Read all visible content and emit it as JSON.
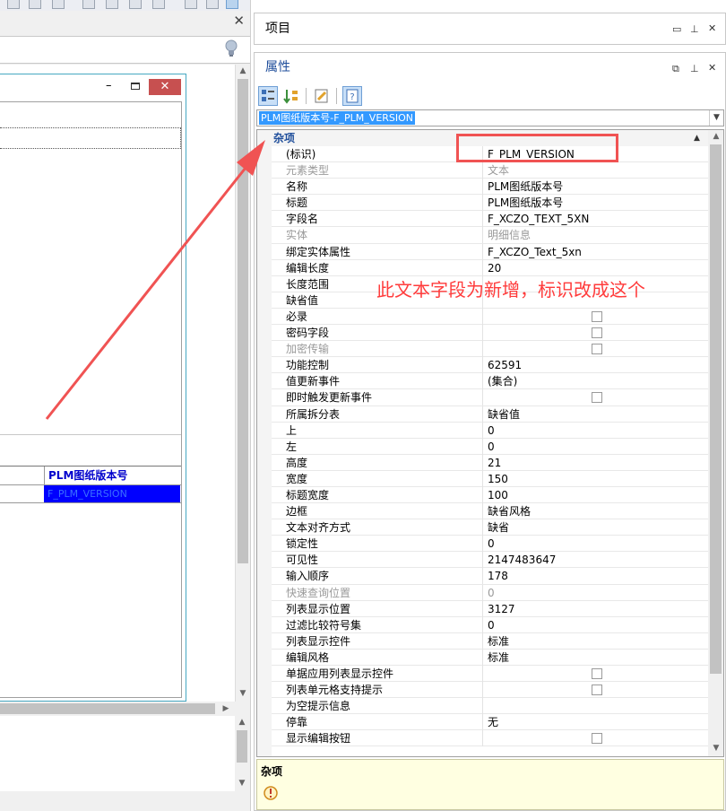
{
  "left_panel": {
    "grid_header": "PLM图纸版本号",
    "grid_cell": "F_PLM_VERSION"
  },
  "project_panel": {
    "title": "项目"
  },
  "properties_panel": {
    "title": "属性",
    "object_selector": "PLM图纸版本号-F_PLM_VERSION",
    "category": "杂项",
    "rows": [
      {
        "name": "(标识)",
        "value": "F_PLM_VERSION",
        "disabled": false
      },
      {
        "name": "元素类型",
        "value": "文本",
        "disabled": true
      },
      {
        "name": "名称",
        "value": "PLM图纸版本号",
        "disabled": false
      },
      {
        "name": "标题",
        "value": "PLM图纸版本号",
        "disabled": false
      },
      {
        "name": "字段名",
        "value": "F_XCZO_TEXT_5XN",
        "disabled": false
      },
      {
        "name": "实体",
        "value": "明细信息",
        "disabled": true
      },
      {
        "name": "绑定实体属性",
        "value": "F_XCZO_Text_5xn",
        "disabled": false
      },
      {
        "name": "编辑长度",
        "value": "20",
        "disabled": false
      },
      {
        "name": "长度范围",
        "value": "",
        "disabled": false
      },
      {
        "name": "缺省值",
        "value": "",
        "disabled": false
      },
      {
        "name": "必录",
        "value": "",
        "checkbox": true,
        "disabled": false
      },
      {
        "name": "密码字段",
        "value": "",
        "checkbox": true,
        "disabled": false
      },
      {
        "name": "加密传输",
        "value": "",
        "checkbox": true,
        "disabled": true
      },
      {
        "name": "功能控制",
        "value": "62591",
        "disabled": false
      },
      {
        "name": "值更新事件",
        "value": "(集合)",
        "disabled": false
      },
      {
        "name": "即时触发更新事件",
        "value": "",
        "checkbox": true,
        "disabled": false
      },
      {
        "name": "所属拆分表",
        "value": "缺省值",
        "disabled": false
      },
      {
        "name": "上",
        "value": "0",
        "disabled": false
      },
      {
        "name": "左",
        "value": "0",
        "disabled": false
      },
      {
        "name": "高度",
        "value": "21",
        "disabled": false
      },
      {
        "name": "宽度",
        "value": "150",
        "disabled": false
      },
      {
        "name": "标题宽度",
        "value": "100",
        "disabled": false
      },
      {
        "name": "边框",
        "value": "缺省风格",
        "disabled": false
      },
      {
        "name": "文本对齐方式",
        "value": "缺省",
        "disabled": false
      },
      {
        "name": "锁定性",
        "value": "0",
        "disabled": false
      },
      {
        "name": "可见性",
        "value": "2147483647",
        "disabled": false
      },
      {
        "name": "输入顺序",
        "value": "178",
        "disabled": false
      },
      {
        "name": "快速查询位置",
        "value": "0",
        "disabled": true
      },
      {
        "name": "列表显示位置",
        "value": "3127",
        "disabled": false
      },
      {
        "name": "过滤比较符号集",
        "value": "0",
        "disabled": false
      },
      {
        "name": "列表显示控件",
        "value": "标准",
        "disabled": false
      },
      {
        "name": "编辑风格",
        "value": "标准",
        "disabled": false
      },
      {
        "name": "单据应用列表显示控件",
        "value": "",
        "checkbox": true,
        "disabled": false
      },
      {
        "name": "列表单元格支持提示",
        "value": "",
        "checkbox": true,
        "disabled": false
      },
      {
        "name": "为空提示信息",
        "value": "",
        "disabled": false
      },
      {
        "name": "停靠",
        "value": "无",
        "disabled": false
      },
      {
        "name": "显示编辑按钮",
        "value": "",
        "checkbox": true,
        "disabled": false
      }
    ],
    "description_title": "杂项"
  },
  "annotation": {
    "text": "此文本字段为新增，标识改成这个",
    "color": "#ff3b3b"
  },
  "colors": {
    "accent": "#3399ff",
    "selection": "#0000ff",
    "close_button": "#c75050",
    "category_text": "#1f4e9b"
  }
}
